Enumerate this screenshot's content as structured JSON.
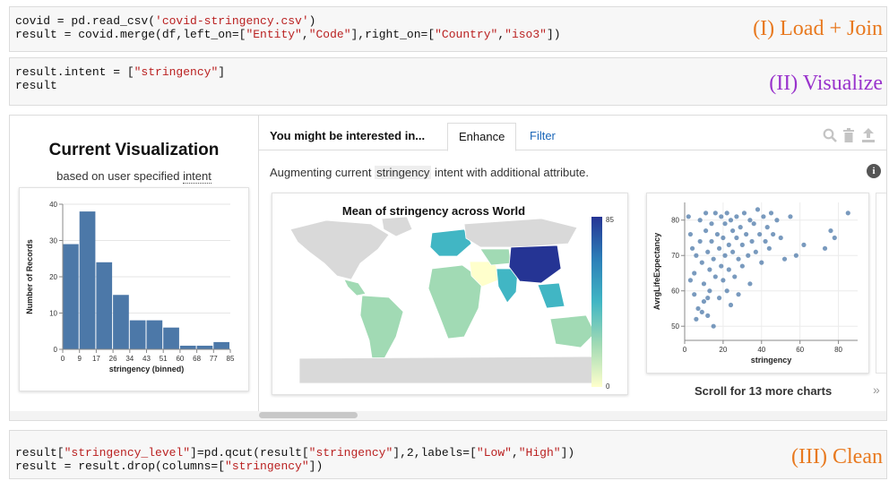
{
  "cell1": {
    "line1": {
      "pre": "covid = pd.read_csv(",
      "s1": "'covid-stringency.csv'",
      "post": ")"
    },
    "line2": {
      "pre": "result = covid.merge(df,left_on=[",
      "s1": "\"Entity\"",
      "m1": ",",
      "s2": "\"Code\"",
      "m2": "],right_on=[",
      "s3": "\"Country\"",
      "m3": ",",
      "s4": "\"iso3\"",
      "post": "])"
    },
    "annotation": "(I) Load + Join"
  },
  "cell2": {
    "line1": {
      "pre": "result.intent = [",
      "s1": "\"stringency\"",
      "post": "]"
    },
    "line2": "result",
    "annotation": "(II) Visualize"
  },
  "cell3": {
    "line1": {
      "pre": "result[",
      "s1": "\"stringency_level\"",
      "m1": "]=pd.qcut(result[",
      "s2": "\"stringency\"",
      "m2": "],2,labels=[",
      "s3": "\"Low\"",
      "m3": ",",
      "s4": "\"High\"",
      "post": "])"
    },
    "line2": {
      "pre": "result = result.drop(columns=[",
      "s1": "\"stringency\"",
      "post": "])"
    },
    "annotation": "(III) Clean"
  },
  "widget": {
    "current_title": "Current Visualization",
    "current_sub_pre": "based on user specified ",
    "current_sub_word": "intent",
    "tabs_title": "You might be interested in...",
    "tab_enhance": "Enhance",
    "tab_filter": "Filter",
    "aug_pre": "Augmenting current ",
    "aug_chip": "stringency",
    "aug_post": " intent with additional attribute.",
    "info_glyph": "i",
    "scroll_more": "Scroll for 13 more charts",
    "chevron": "»",
    "icons": [
      "search-icon",
      "trash-icon",
      "upload-icon"
    ]
  },
  "chart_data": [
    {
      "type": "bar",
      "categories": [
        "0-9",
        "9-17",
        "17-26",
        "26-34",
        "34-43",
        "43-51",
        "51-60",
        "60-68",
        "68-77",
        "77-85"
      ],
      "values": [
        29,
        38,
        24,
        15,
        8,
        8,
        6,
        1,
        1,
        2
      ],
      "xlabel": "stringency (binned)",
      "ylabel": "Number of Records",
      "x_ticks": [
        "0",
        "9",
        "17",
        "26",
        "34",
        "43",
        "51",
        "60",
        "68",
        "77",
        "85"
      ],
      "y_ticks": [
        0,
        10,
        20,
        30,
        40
      ],
      "ylim": [
        0,
        40
      ],
      "color": "#4c78a8"
    },
    {
      "type": "heatmap",
      "title": "Mean of stringency across World",
      "legend_min": "0",
      "legend_max": "85",
      "colors": [
        "#ffffcc",
        "#a1dab4",
        "#41b6c4",
        "#2c7fb8",
        "#253494"
      ],
      "no_data_color": "#d9d9d9"
    },
    {
      "type": "scatter",
      "xlabel": "stringency",
      "ylabel": "AvrgLifeExpectancy",
      "x_ticks": [
        0,
        20,
        40,
        60,
        80
      ],
      "y_ticks": [
        50,
        60,
        70,
        80
      ],
      "xlim": [
        0,
        90
      ],
      "ylim": [
        46,
        85
      ],
      "color": "#4c78a8",
      "points": [
        [
          2,
          81
        ],
        [
          3,
          76
        ],
        [
          4,
          72
        ],
        [
          5,
          65
        ],
        [
          5,
          59
        ],
        [
          6,
          70
        ],
        [
          7,
          55
        ],
        [
          8,
          80
        ],
        [
          8,
          74
        ],
        [
          9,
          68
        ],
        [
          10,
          62
        ],
        [
          10,
          57
        ],
        [
          11,
          82
        ],
        [
          11,
          77
        ],
        [
          12,
          71
        ],
        [
          12,
          53
        ],
        [
          13,
          66
        ],
        [
          13,
          60
        ],
        [
          14,
          79
        ],
        [
          14,
          74
        ],
        [
          15,
          69
        ],
        [
          15,
          50
        ],
        [
          16,
          64
        ],
        [
          16,
          82
        ],
        [
          17,
          76
        ],
        [
          18,
          72
        ],
        [
          18,
          58
        ],
        [
          19,
          81
        ],
        [
          19,
          67
        ],
        [
          20,
          75
        ],
        [
          20,
          63
        ],
        [
          21,
          79
        ],
        [
          21,
          70
        ],
        [
          22,
          82
        ],
        [
          22,
          60
        ],
        [
          23,
          73
        ],
        [
          23,
          66
        ],
        [
          24,
          80
        ],
        [
          24,
          56
        ],
        [
          25,
          77
        ],
        [
          25,
          71
        ],
        [
          26,
          64
        ],
        [
          27,
          81
        ],
        [
          27,
          75
        ],
        [
          28,
          69
        ],
        [
          28,
          59
        ],
        [
          29,
          78
        ],
        [
          30,
          73
        ],
        [
          30,
          67
        ],
        [
          31,
          82
        ],
        [
          32,
          76
        ],
        [
          33,
          70
        ],
        [
          34,
          80
        ],
        [
          34,
          62
        ],
        [
          35,
          74
        ],
        [
          36,
          79
        ],
        [
          37,
          71
        ],
        [
          38,
          83
        ],
        [
          39,
          76
        ],
        [
          40,
          68
        ],
        [
          41,
          81
        ],
        [
          42,
          74
        ],
        [
          43,
          78
        ],
        [
          44,
          72
        ],
        [
          45,
          82
        ],
        [
          46,
          76
        ],
        [
          48,
          80
        ],
        [
          50,
          75
        ],
        [
          52,
          69
        ],
        [
          55,
          81
        ],
        [
          58,
          70
        ],
        [
          62,
          73
        ],
        [
          73,
          72
        ],
        [
          76,
          77
        ],
        [
          78,
          75
        ],
        [
          85,
          82
        ],
        [
          3,
          63
        ],
        [
          6,
          52
        ],
        [
          9,
          54
        ],
        [
          12,
          58
        ]
      ]
    }
  ]
}
